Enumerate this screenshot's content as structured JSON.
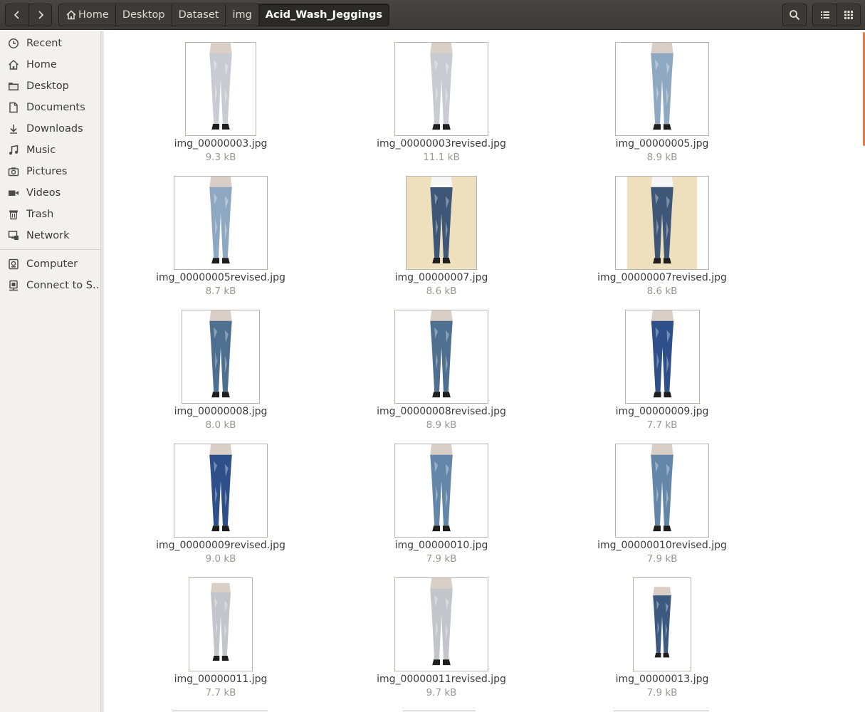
{
  "header": {
    "back_icon": "chevron-left-icon",
    "forward_icon": "chevron-right-icon",
    "breadcrumb": [
      "Home",
      "Desktop",
      "Dataset",
      "img",
      "Acid_Wash_Jeggings"
    ],
    "search_icon": "search-icon",
    "list_view_icon": "list-view-icon",
    "grid_view_icon": "grid-view-icon"
  },
  "sidebar": {
    "items": [
      {
        "label": "Recent",
        "icon": "clock-icon"
      },
      {
        "label": "Home",
        "icon": "home-icon"
      },
      {
        "label": "Desktop",
        "icon": "folder-icon"
      },
      {
        "label": "Documents",
        "icon": "document-icon"
      },
      {
        "label": "Downloads",
        "icon": "download-icon"
      },
      {
        "label": "Music",
        "icon": "music-icon"
      },
      {
        "label": "Pictures",
        "icon": "camera-icon"
      },
      {
        "label": "Videos",
        "icon": "video-icon"
      },
      {
        "label": "Trash",
        "icon": "trash-icon"
      },
      {
        "label": "Network",
        "icon": "network-icon"
      }
    ],
    "devices": [
      {
        "label": "Computer",
        "icon": "computer-icon"
      },
      {
        "label": "Connect to S…",
        "icon": "server-icon"
      }
    ]
  },
  "files": [
    {
      "name": "img_00000003.jpg",
      "size": "9.3 kB",
      "bg": "#ffffff",
      "denim": "#c8ccd2"
    },
    {
      "name": "img_00000003revised.jpg",
      "size": "11.1 kB",
      "bg": "#ffffff",
      "denim": "#c8ccd2"
    },
    {
      "name": "img_00000005.jpg",
      "size": "8.9 kB",
      "bg": "#ffffff",
      "denim": "#8fa8c2"
    },
    {
      "name": "img_00000005revised.jpg",
      "size": "8.7 kB",
      "bg": "#ffffff",
      "denim": "#8fa8c2"
    },
    {
      "name": "img_00000007.jpg",
      "size": "8.6 kB",
      "bg": "#efe0bd",
      "denim": "#3e5677"
    },
    {
      "name": "img_00000007revised.jpg",
      "size": "8.6 kB",
      "bg": "#efe0bd",
      "denim": "#3e5677"
    },
    {
      "name": "img_00000008.jpg",
      "size": "8.0 kB",
      "bg": "#ffffff",
      "denim": "#4e6f8f"
    },
    {
      "name": "img_00000008revised.jpg",
      "size": "8.9 kB",
      "bg": "#ffffff",
      "denim": "#4e6f8f"
    },
    {
      "name": "img_00000009.jpg",
      "size": "7.7 kB",
      "bg": "#ffffff",
      "denim": "#2f4f8a"
    },
    {
      "name": "img_00000009revised.jpg",
      "size": "9.0 kB",
      "bg": "#ffffff",
      "denim": "#2f4f8a"
    },
    {
      "name": "img_00000010.jpg",
      "size": "7.9 kB",
      "bg": "#ffffff",
      "denim": "#6486a8"
    },
    {
      "name": "img_00000010revised.jpg",
      "size": "7.9 kB",
      "bg": "#ffffff",
      "denim": "#6486a8"
    },
    {
      "name": "img_00000011.jpg",
      "size": "7.7 kB",
      "bg": "#ffffff",
      "denim": "#c2c5ca"
    },
    {
      "name": "img_00000011revised.jpg",
      "size": "9.7 kB",
      "bg": "#ffffff",
      "denim": "#c2c5ca"
    },
    {
      "name": "img_00000013.jpg",
      "size": "7.9 kB",
      "bg": "#ffffff",
      "denim": "#3c5a80"
    }
  ]
}
